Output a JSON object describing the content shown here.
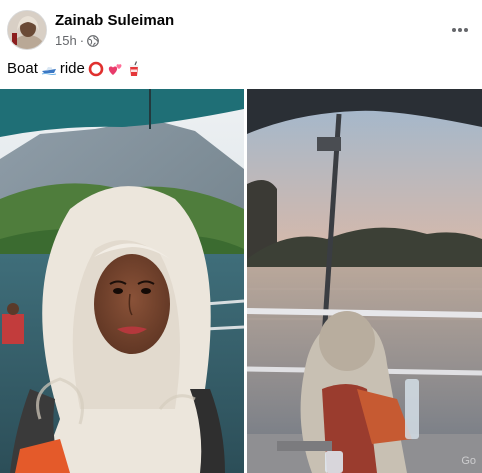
{
  "post": {
    "author": "Zainab Suleiman",
    "timestamp": "15h",
    "separator": "·",
    "audience_icon": "globe-icon",
    "caption_words": [
      "Boat",
      "ride"
    ],
    "caption_emojis": [
      "speedboat-emoji",
      "hollow-red-circle-emoji",
      "two-hearts-emoji",
      "cup-with-straw-emoji"
    ]
  },
  "photos": [
    {
      "icon": "photo-selfie-lace-scarf"
    },
    {
      "icon": "photo-sunset-boat-view"
    }
  ],
  "colors": {
    "secondary_text": "#65676b",
    "primary_text": "#050505"
  }
}
